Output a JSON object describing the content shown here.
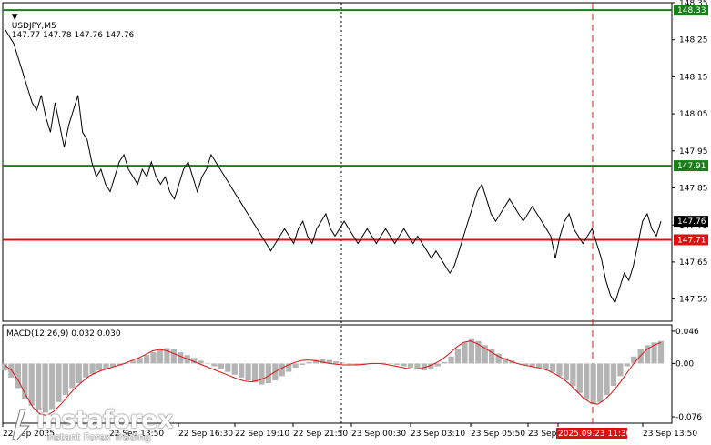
{
  "header": {
    "symbol": "USDJPY,M5",
    "ohlc": "147.77 147.78 147.76 147.76",
    "macd_label": "MACD(12,26,9) 0.032 0.030"
  },
  "watermark": {
    "brand": "instaforex",
    "tagline": "Instant Forex Trading"
  },
  "colors": {
    "price_line": "#000000",
    "green_level": "#1a7f1a",
    "red_level": "#e01010",
    "histogram": "#b4b4b4",
    "signal": "#e01010",
    "axis": "#000000",
    "highlight_bg": "#e01010"
  },
  "chart_data": [
    {
      "type": "line",
      "title": "USDJPY,M5",
      "ylim": [
        147.49,
        148.35
      ],
      "y_ticks": [
        "148.35",
        "148.25",
        "148.15",
        "148.05",
        "147.95",
        "147.85",
        "147.75",
        "147.65",
        "147.55"
      ],
      "levels": [
        {
          "value": 148.33,
          "label": "148.33",
          "color": "green"
        },
        {
          "value": 147.91,
          "label": "147.91",
          "color": "green"
        },
        {
          "value": 147.71,
          "label": "147.71",
          "color": "red"
        }
      ],
      "current_price": {
        "value": 147.76,
        "label": "147.76"
      },
      "x_ticks": [
        "22 Sep 2025",
        "22 Sep 13:50",
        "22 Sep 16:30",
        "22 Sep 19:10",
        "22 Sep 21:50",
        "23 Sep 00:30",
        "23 Sep 03:10",
        "23 Sep 05:50",
        "23 Sep",
        "2025.09.23 11:30",
        "23 Sep 13:50"
      ],
      "vertical_markers": [
        {
          "label": "22 Sep 21:50",
          "style": "dotted"
        },
        {
          "label": "2025.09.23 11:30",
          "style": "dashed-red"
        }
      ],
      "series": [
        {
          "values": [
            148.28,
            148.26,
            148.24,
            148.2,
            148.16,
            148.12,
            148.08,
            148.06,
            148.1,
            148.04,
            148.0,
            148.08,
            148.02,
            147.96,
            148.02,
            148.06,
            148.1,
            148.0,
            147.98,
            147.92,
            147.88,
            147.9,
            147.86,
            147.84,
            147.88,
            147.92,
            147.94,
            147.9,
            147.88,
            147.86,
            147.9,
            147.88,
            147.92,
            147.88,
            147.86,
            147.88,
            147.84,
            147.82,
            147.86,
            147.9,
            147.92,
            147.88,
            147.84,
            147.88,
            147.9,
            147.94,
            147.92,
            147.9,
            147.88,
            147.86,
            147.84,
            147.82,
            147.8,
            147.78,
            147.76,
            147.74,
            147.72,
            147.7,
            147.68,
            147.7,
            147.72,
            147.74,
            147.72,
            147.7,
            147.74,
            147.76,
            147.72,
            147.7,
            147.74,
            147.76,
            147.78,
            147.74,
            147.72,
            147.74,
            147.76,
            147.74,
            147.72,
            147.7,
            147.72,
            147.74,
            147.72,
            147.7,
            147.72,
            147.74,
            147.72,
            147.7,
            147.72,
            147.74,
            147.72,
            147.7,
            147.72,
            147.7,
            147.68,
            147.66,
            147.68,
            147.66,
            147.64,
            147.62,
            147.64,
            147.68,
            147.72,
            147.76,
            147.8,
            147.84,
            147.86,
            147.82,
            147.78,
            147.76,
            147.78,
            147.8,
            147.82,
            147.8,
            147.78,
            147.76,
            147.78,
            147.8,
            147.78,
            147.76,
            147.74,
            147.72,
            147.66,
            147.72,
            147.76,
            147.78,
            147.74,
            147.72,
            147.7,
            147.72,
            147.74,
            147.7,
            147.66,
            147.6,
            147.56,
            147.54,
            147.58,
            147.62,
            147.6,
            147.64,
            147.7,
            147.76,
            147.78,
            147.74,
            147.72,
            147.76
          ]
        },
        {
          "type": "bar",
          "title": "MACD(12,26,9) 0.032 0.030",
          "name": "MACD",
          "ylim": [
            -0.085,
            0.055
          ],
          "y_ticks": [
            "0.046",
            "0.00",
            "-0.076"
          ],
          "histogram": [
            -0.01,
            -0.02,
            -0.035,
            -0.05,
            -0.06,
            -0.068,
            -0.07,
            -0.065,
            -0.055,
            -0.045,
            -0.035,
            -0.028,
            -0.02,
            -0.015,
            -0.01,
            -0.008,
            -0.005,
            -0.003,
            0.0,
            0.004,
            0.008,
            0.012,
            0.016,
            0.02,
            0.022,
            0.02,
            0.016,
            0.012,
            0.008,
            0.004,
            0.0,
            -0.004,
            -0.008,
            -0.012,
            -0.016,
            -0.02,
            -0.024,
            -0.027,
            -0.03,
            -0.028,
            -0.024,
            -0.018,
            -0.012,
            -0.006,
            -0.002,
            0.002,
            0.005,
            0.006,
            0.005,
            0.003,
            0.001,
            -0.001,
            -0.002,
            -0.002,
            -0.001,
            0.0,
            0.001,
            0.0,
            -0.002,
            -0.004,
            -0.006,
            -0.008,
            -0.01,
            -0.008,
            -0.004,
            0.002,
            0.01,
            0.02,
            0.03,
            0.036,
            0.032,
            0.026,
            0.02,
            0.014,
            0.008,
            0.004,
            0.0,
            -0.002,
            -0.004,
            -0.006,
            -0.008,
            -0.012,
            -0.018,
            -0.024,
            -0.032,
            -0.042,
            -0.052,
            -0.058,
            -0.055,
            -0.045,
            -0.032,
            -0.018,
            -0.004,
            0.01,
            0.02,
            0.026,
            0.03,
            0.032
          ]
        },
        {
          "name": "Signal",
          "values": [
            -0.002,
            -0.01,
            -0.025,
            -0.045,
            -0.062,
            -0.072,
            -0.074,
            -0.068,
            -0.058,
            -0.046,
            -0.035,
            -0.026,
            -0.018,
            -0.013,
            -0.009,
            -0.006,
            -0.003,
            0.0,
            0.004,
            0.008,
            0.013,
            0.018,
            0.02,
            0.018,
            0.014,
            0.01,
            0.006,
            0.002,
            -0.002,
            -0.006,
            -0.01,
            -0.014,
            -0.018,
            -0.022,
            -0.025,
            -0.026,
            -0.024,
            -0.02,
            -0.014,
            -0.008,
            -0.003,
            0.001,
            0.004,
            0.005,
            0.004,
            0.002,
            0.0,
            -0.001,
            -0.002,
            -0.002,
            -0.002,
            -0.001,
            0.0,
            0.0,
            -0.001,
            -0.003,
            -0.005,
            -0.007,
            -0.008,
            -0.007,
            -0.004,
            0.0,
            0.006,
            0.014,
            0.023,
            0.03,
            0.032,
            0.028,
            0.022,
            0.016,
            0.01,
            0.006,
            0.002,
            -0.001,
            -0.003,
            -0.005,
            -0.007,
            -0.01,
            -0.015,
            -0.021,
            -0.029,
            -0.039,
            -0.049,
            -0.056,
            -0.058,
            -0.052,
            -0.042,
            -0.03,
            -0.016,
            -0.002,
            0.01,
            0.02,
            0.026,
            0.03
          ]
        }
      ]
    }
  ]
}
